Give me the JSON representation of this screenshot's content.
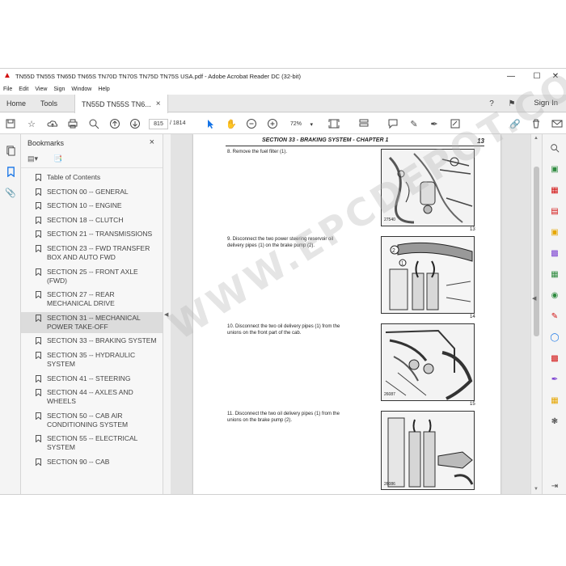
{
  "window": {
    "title": "TN55D TN55S TN65D TN65S TN70D TN70S TN75D TN75S USA.pdf - Adobe Acrobat Reader DC (32-bit)",
    "controls": [
      "—",
      "☐",
      "✕"
    ]
  },
  "menu": [
    "File",
    "Edit",
    "View",
    "Sign",
    "Window",
    "Help"
  ],
  "tabs": {
    "home": "Home",
    "tools": "Tools",
    "document": "TN55D TN55S TN6...",
    "close": "×",
    "sign_in": "Sign In"
  },
  "toolbar": {
    "current_page": "815",
    "total_pages": "/ 1814",
    "zoom": "72%",
    "active_tool": "select-cursor"
  },
  "bookmarks": {
    "title": "Bookmarks",
    "close": "×",
    "items": [
      {
        "label": "Table of Contents",
        "selected": false
      },
      {
        "label": "SECTION 00 -- GENERAL",
        "selected": false
      },
      {
        "label": "SECTION 10 -- ENGINE",
        "selected": false
      },
      {
        "label": "SECTION 18 -- CLUTCH",
        "selected": false
      },
      {
        "label": "SECTION 21 -- TRANSMISSIONS",
        "selected": false
      },
      {
        "label": "SECTION 23 -- FWD TRANSFER BOX AND AUTO FWD",
        "selected": false
      },
      {
        "label": "SECTION 25 -- FRONT AXLE (FWD)",
        "selected": false
      },
      {
        "label": "SECTION 27 -- REAR MECHANICAL DRIVE",
        "selected": false
      },
      {
        "label": "SECTION 31 -- MECHANICAL POWER TAKE-OFF",
        "selected": true
      },
      {
        "label": "SECTION 33 -- BRAKING SYSTEM",
        "selected": false
      },
      {
        "label": "SECTION 35 -- HYDRAULIC SYSTEM",
        "selected": false
      },
      {
        "label": "SECTION 41 -- STEERING",
        "selected": false
      },
      {
        "label": "SECTION 44 -- AXLES AND WHEELS",
        "selected": false
      },
      {
        "label": "SECTION 50 -- CAB AIR CONDITIONING SYSTEM",
        "selected": false
      },
      {
        "label": "SECTION 55 -- ELECTRICAL SYSTEM",
        "selected": false
      },
      {
        "label": "SECTION 90 -- CAB",
        "selected": false
      }
    ]
  },
  "page": {
    "header": "SECTION 33 - BRAKING SYSTEM - CHAPTER 1",
    "page_number": "13",
    "steps": [
      {
        "text": "8.   Remove the fuel filter (1).",
        "fig_label": "27540",
        "fig_number": "13"
      },
      {
        "text": "9.   Disconnect the two power steering reservoir oil delivery pipes (1) on the brake pump (2).",
        "fig_label": "",
        "fig_number": "14"
      },
      {
        "text": "10.  Disconnect the two oil delivery pipes (1) from the unions on the front part of the cab.",
        "fig_label": "26087",
        "fig_number": "15"
      },
      {
        "text": "11.  Disconnect the two oil delivery pipes (1) from the unions on the brake pump (2).",
        "fig_label": "26086",
        "fig_number": ""
      }
    ]
  },
  "watermark": "WWW.EPCDEPOT.COM",
  "colors": {
    "accent": "#1473e6",
    "acrobat_red": "#d21010",
    "selection": "#dcdcdc"
  }
}
